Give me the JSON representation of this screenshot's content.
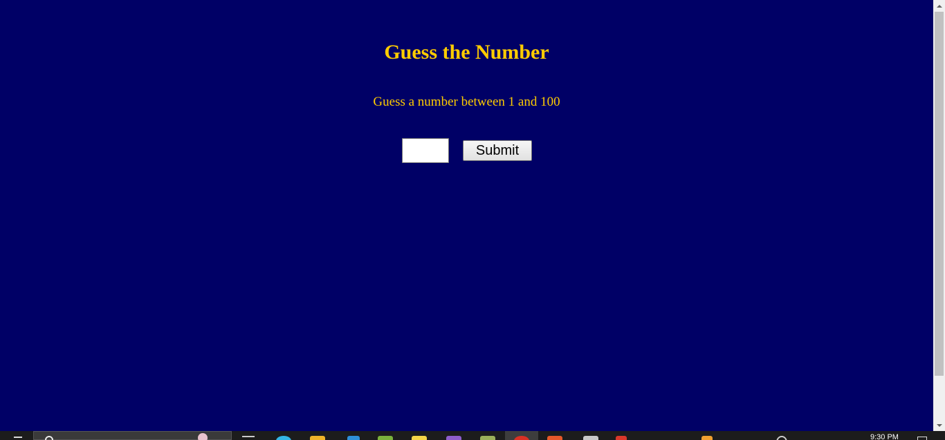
{
  "page": {
    "title": "Guess the Number",
    "instruction": "Guess a number between 1 and 100"
  },
  "form": {
    "guess_value": "",
    "submit_label": "Submit"
  },
  "taskbar": {
    "clock": "9:30 PM",
    "icons": [
      "start-icon",
      "search-icon",
      "task-view-icon",
      "edge-icon",
      "file-explorer-icon",
      "vscode-icon",
      "app-green-icon",
      "sticky-notes-icon",
      "visual-studio-icon",
      "app-olive-icon",
      "chrome-icon",
      "office-icon",
      "flag-icon",
      "acrobat-icon",
      "database-icon",
      "network-icon",
      "notification-icon"
    ]
  },
  "colors": {
    "background": "#000066",
    "text": "#FFCC00"
  }
}
